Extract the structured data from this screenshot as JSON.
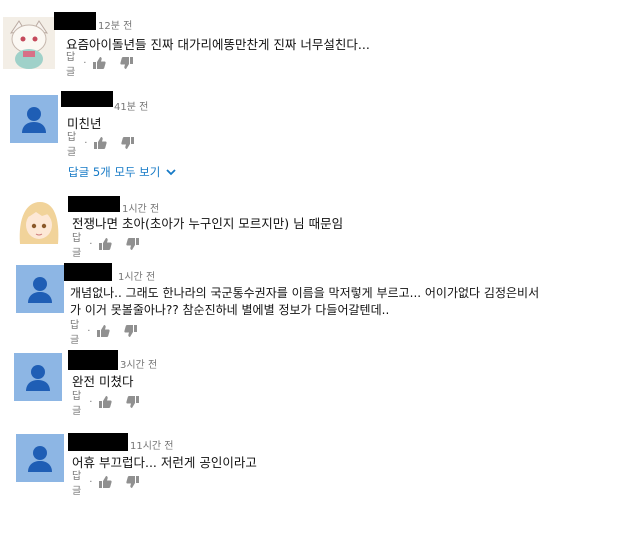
{
  "comments": [
    {
      "time": "12분 전",
      "text": "요즘아이돌년들 진짜 대가리에똥만찬게 진짜 너무설친다...",
      "reply": "답글",
      "dot": "·"
    },
    {
      "time": "41분 전",
      "text": "미친년",
      "reply": "답글",
      "dot": "·"
    },
    {
      "time": "1시간 전",
      "text": "전쟁나면 초아(초아가 누구인지 모르지만) 님 때문임",
      "reply": "답글",
      "dot": "·"
    },
    {
      "time": "1시간 전",
      "text_line1": "개념없나.. 그래도 한나라의 국군통수권자를 이름을 막저렇게 부르고... 어이가없다 김정은비서",
      "text_line2": "가 이거 못볼줄아나?? 참순진하네 별에별 정보가 다들어갈텐데..",
      "reply": "답글",
      "dot": "·"
    },
    {
      "time": "3시간 전",
      "text": "완전 미쳤다",
      "reply": "답글",
      "dot": "·"
    },
    {
      "time": "11시간 전",
      "text": "어휴 부끄럽다... 저런게 공인이라고",
      "reply": "답글",
      "dot": "·"
    }
  ],
  "view_replies": "답글 5개 모두 보기",
  "icons": {
    "like": "thumbs-up-icon",
    "dislike": "thumbs-down-icon",
    "expand": "chevron-down-icon",
    "avatar": "default-user-icon"
  },
  "colors": {
    "link": "#167ac6",
    "avatar_bg": "#8db6e4",
    "avatar_fg": "#1f5eb5",
    "meta": "#767676"
  }
}
